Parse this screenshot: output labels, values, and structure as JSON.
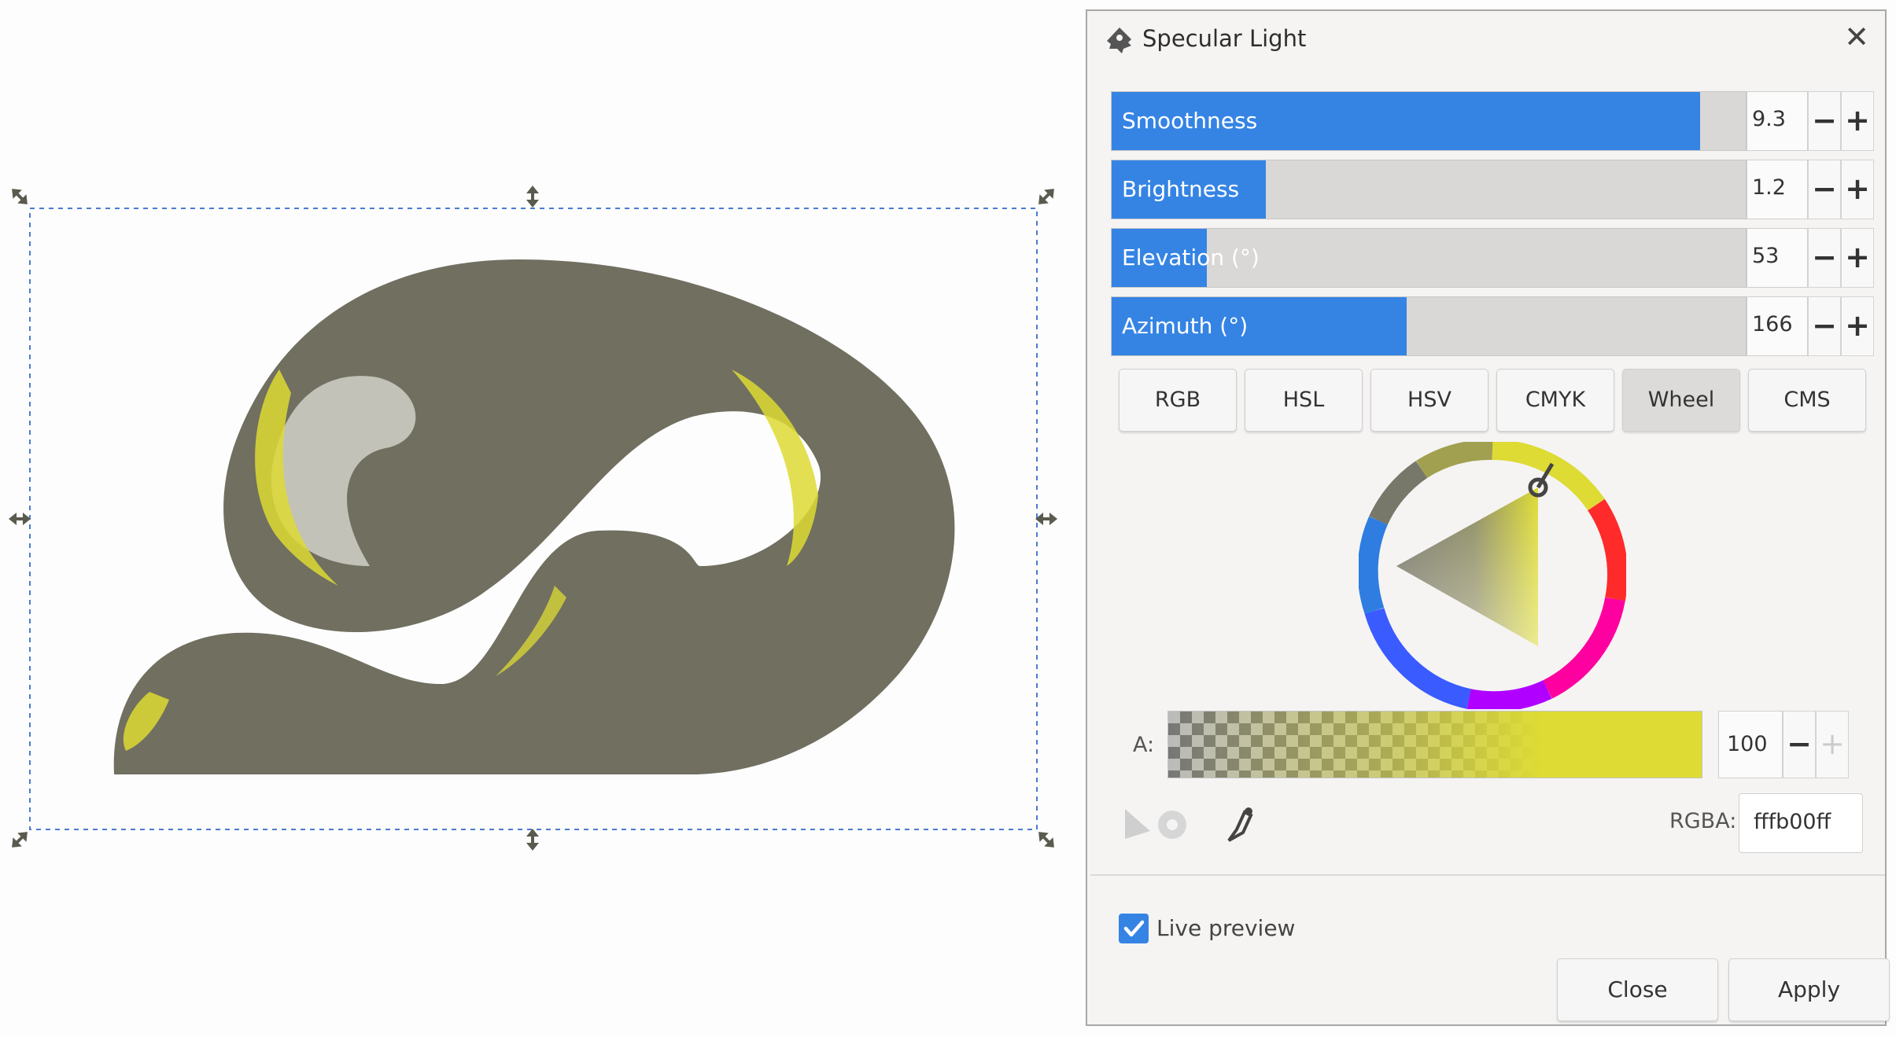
{
  "dialog": {
    "title": "Specular Light",
    "sliders": [
      {
        "label": "Smoothness",
        "value": "9.3",
        "fill_fraction": 0.93
      },
      {
        "label": "Brightness",
        "value": "1.2",
        "fill_fraction": 0.24
      },
      {
        "label": "Elevation (°)",
        "value": "53",
        "fill_fraction": 0.15
      },
      {
        "label": "Azimuth (°)",
        "value": "166",
        "fill_fraction": 0.46
      }
    ],
    "color_modes": [
      "RGB",
      "HSL",
      "HSV",
      "CMYK",
      "Wheel",
      "CMS"
    ],
    "active_mode": "Wheel",
    "alpha": {
      "label": "A:",
      "value": "100"
    },
    "rgba": {
      "label": "RGBA:",
      "value": "fffb00ff"
    },
    "live_preview": {
      "label": "Live preview",
      "checked": true
    },
    "buttons": {
      "close": "Close",
      "apply": "Apply"
    }
  },
  "colors": {
    "accent": "#3584e4",
    "shape_fill": "#706f60",
    "highlight": "#dddb34"
  },
  "icons": {
    "title": "inkscape-logo-icon",
    "close": "close-icon",
    "triangle": "triangle-picker-icon",
    "ring": "ring-picker-icon",
    "dropper": "eyedropper-icon"
  }
}
